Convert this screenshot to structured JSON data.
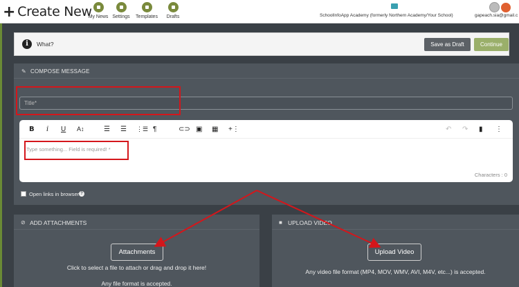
{
  "header": {
    "title": "Create New",
    "nav": [
      {
        "label": "My News",
        "icon": "news-icon"
      },
      {
        "label": "Settings",
        "icon": "gear-icon"
      },
      {
        "label": "Templates",
        "icon": "templates-icon"
      },
      {
        "label": "Drafts",
        "icon": "pencil-icon"
      }
    ],
    "school": "SchoolInfoApp Academy (formerly Northern Academy/Your School)",
    "email": "gapeach.sia@gmail.c"
  },
  "what_bar": {
    "label": "What?",
    "save_draft": "Save as Draft",
    "continue": "Continue"
  },
  "compose": {
    "heading": "COMPOSE MESSAGE",
    "title_placeholder": "Title*",
    "editor_placeholder": "Type something... Field is required! *",
    "characters": "Characters : 0",
    "open_links": "Open links in browser"
  },
  "toolbar": {
    "bold": "B",
    "italic": "i",
    "underline": "U",
    "font_size": "A↕",
    "paragraph": "¶",
    "more": "⋮",
    "insert": "+⋮"
  },
  "attachments": {
    "heading": "ADD ATTACHMENTS",
    "button": "Attachments",
    "line1": "Click to select a file to attach or drag and drop it here!",
    "line2": "Any file format is accepted."
  },
  "video": {
    "heading": "UPLOAD VIDEO",
    "button": "Upload Video",
    "line1": "Any video file format (MP4, MOV, WMV, AVI, M4V, etc...) is accepted."
  },
  "colors": {
    "accent": "#7a8a3c",
    "panel": "#4f565d",
    "background": "#3a4046",
    "annotation": "#d4161b"
  }
}
